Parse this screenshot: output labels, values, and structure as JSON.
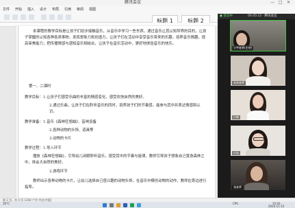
{
  "window": {
    "title": "腾讯会议",
    "controls": [
      "—",
      "□",
      "✕"
    ]
  },
  "ribbon": {
    "tabs": [
      "文件",
      "开始",
      "插入",
      "设计",
      "布局",
      "引用",
      "审阅",
      "视图"
    ],
    "style1": "标题 1",
    "style2": "标题 2"
  },
  "document": {
    "paragraphs": [
      {
        "text": "本课程的教学目标是让孩子们初步接触音乐，从音乐中学习一些东西，通过音乐让其认知世界的目的，让孩子掌握的认知各种各类事物，发挥想象力和创造力，让孩子们在活动中享受音乐带来的乐趣，培养音乐情趣，提高审美能力；把传播情感与感知音乐相结合，让孩子在音乐活动中，更好地体验音乐的快乐。"
      },
      {
        "text": "第一、二课时"
      },
      {
        "text": "教学目标：1.让孩子们感受乐曲的丰富的情感变化，感受欢快自然的美好。"
      },
      {
        "text": "2.通过乐曲，让孩子们在聆听音乐的同时，培养孩子们的节奏感，能参与其中并表达情感和认识。"
      },
      {
        "text": "教学准备：1.音乐《森林狂想曲》、音响设备"
      },
      {
        "text": "2.各种动物的头饰、道具等"
      },
      {
        "text": "3.动物的卡片"
      },
      {
        "text": "教学过程：1.导入环节"
      },
      {
        "text": "播放《森林狂想曲》，引导幼儿闭眼聆听音乐，感受其中的节奏与旋律，教师引导孩子想象自己置身森林之中，体会大自然的美好。"
      },
      {
        "text": "2.游戏环节"
      },
      {
        "text": "教师出示各种动物的卡片，让幼儿选择自己感兴趣的动物头饰，在音乐中模仿动物的动作，教师在旁边进行指导。"
      }
    ]
  },
  "status": {
    "text": "第 2 页，共 4 页  1268 个字  中文(中国)"
  },
  "meeting": {
    "header_left": "● 会议中",
    "header_right": "00:45:12 · 腾讯会议",
    "participants": [
      {
        "name": "小宇老师(主持)",
        "active": true
      },
      {
        "name": "欢欢老师",
        "active": false
      },
      {
        "name": "小林",
        "active": false
      },
      {
        "name": "小云",
        "active": false
      },
      {
        "name": "张老师",
        "active": false
      }
    ]
  },
  "taskbar": {
    "time": "15:03",
    "date": "2024-11-15",
    "temp": "10°C",
    "cpu": "CPU"
  },
  "colors": {
    "accent": "#3fc03f",
    "panel": "#1b1b1b"
  }
}
